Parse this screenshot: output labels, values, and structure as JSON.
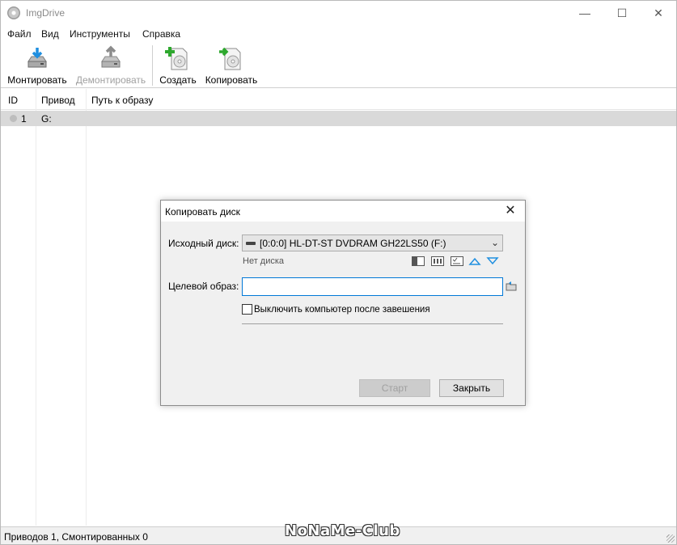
{
  "window": {
    "title": "ImgDrive",
    "controls": {
      "minimize": "—",
      "maximize": "☐",
      "close": "✕"
    }
  },
  "menu": [
    "Файл",
    "Вид",
    "Инструменты",
    "Справка"
  ],
  "toolbar": {
    "mount": "Монтировать",
    "unmount": "Демонтировать",
    "create": "Создать",
    "copy": "Копировать"
  },
  "list": {
    "columns": [
      "ID",
      "Привод",
      "Путь к образу"
    ],
    "rows": [
      {
        "id": "1",
        "drive": "G:",
        "path": ""
      }
    ]
  },
  "status": {
    "text": "Приводов 1, Смонтированных 0"
  },
  "watermark": "NoNaMe-Club",
  "dialog": {
    "title": "Копировать диск",
    "close": "✕",
    "source_label": "Исходный диск:",
    "source_value": "[0:0:0] HL-DT-ST DVDRAM GH22LS50 (F:)",
    "source_status": "Нет диска",
    "target_label": "Целевой образ:",
    "target_value": "",
    "shutdown_label": "Выключить компьютер после завешения",
    "shutdown_checked": false,
    "start_button": "Старт",
    "close_button": "Закрыть"
  },
  "colors": {
    "accent": "#0078d7",
    "row_selected": "#d9d9d9",
    "dialog_bg": "#f0f0f0"
  }
}
